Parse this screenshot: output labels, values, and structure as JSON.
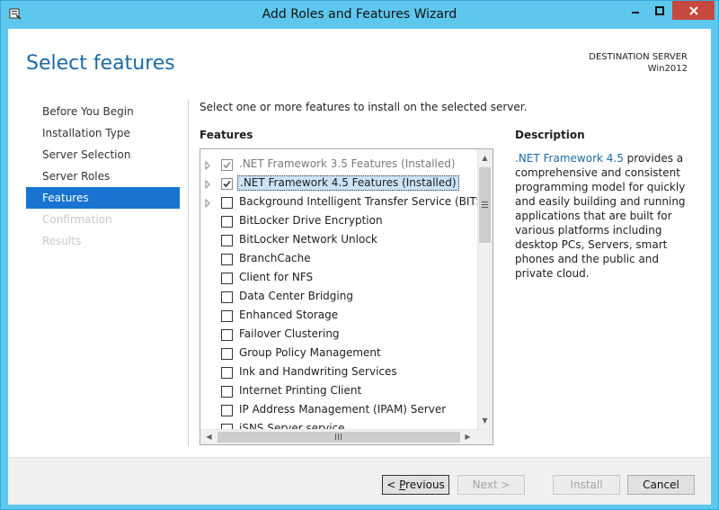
{
  "window": {
    "title": "Add Roles and Features Wizard"
  },
  "page": {
    "title": "Select features"
  },
  "destination": {
    "label": "DESTINATION SERVER",
    "server": "Win2012"
  },
  "nav": {
    "items": [
      {
        "label": "Before You Begin",
        "state": "normal"
      },
      {
        "label": "Installation Type",
        "state": "normal"
      },
      {
        "label": "Server Selection",
        "state": "normal"
      },
      {
        "label": "Server Roles",
        "state": "normal"
      },
      {
        "label": "Features",
        "state": "active"
      },
      {
        "label": "Confirmation",
        "state": "disabled"
      },
      {
        "label": "Results",
        "state": "disabled"
      }
    ]
  },
  "main": {
    "intro": "Select one or more features to install on the selected server.",
    "features_label": "Features",
    "features": [
      {
        "label": ".NET Framework 3.5 Features (Installed)",
        "expandable": true,
        "checked": true,
        "installed": true,
        "selected": false
      },
      {
        "label": ".NET Framework 4.5 Features (Installed)",
        "expandable": true,
        "checked": true,
        "installed": false,
        "selected": true
      },
      {
        "label": "Background Intelligent Transfer Service (BITS)",
        "expandable": true,
        "checked": false,
        "installed": false,
        "selected": false
      },
      {
        "label": "BitLocker Drive Encryption",
        "expandable": false,
        "checked": false,
        "installed": false,
        "selected": false
      },
      {
        "label": "BitLocker Network Unlock",
        "expandable": false,
        "checked": false,
        "installed": false,
        "selected": false
      },
      {
        "label": "BranchCache",
        "expandable": false,
        "checked": false,
        "installed": false,
        "selected": false
      },
      {
        "label": "Client for NFS",
        "expandable": false,
        "checked": false,
        "installed": false,
        "selected": false
      },
      {
        "label": "Data Center Bridging",
        "expandable": false,
        "checked": false,
        "installed": false,
        "selected": false
      },
      {
        "label": "Enhanced Storage",
        "expandable": false,
        "checked": false,
        "installed": false,
        "selected": false
      },
      {
        "label": "Failover Clustering",
        "expandable": false,
        "checked": false,
        "installed": false,
        "selected": false
      },
      {
        "label": "Group Policy Management",
        "expandable": false,
        "checked": false,
        "installed": false,
        "selected": false
      },
      {
        "label": "Ink and Handwriting Services",
        "expandable": false,
        "checked": false,
        "installed": false,
        "selected": false
      },
      {
        "label": "Internet Printing Client",
        "expandable": false,
        "checked": false,
        "installed": false,
        "selected": false
      },
      {
        "label": "IP Address Management (IPAM) Server",
        "expandable": false,
        "checked": false,
        "installed": false,
        "selected": false
      },
      {
        "label": "iSNS Server service",
        "expandable": false,
        "checked": false,
        "installed": false,
        "selected": false
      }
    ]
  },
  "description": {
    "title": "Description",
    "link_text": ".NET Framework 4.5",
    "text": " provides a comprehensive and consistent programming model for quickly and easily building and running applications that are built for various platforms including desktop PCs, Servers, smart phones and the public and private cloud."
  },
  "buttons": {
    "previous_prefix": "< ",
    "previous_key": "P",
    "previous_rest": "revious",
    "next": "Next >",
    "install": "Install",
    "cancel": "Cancel"
  },
  "colors": {
    "accent": "#1874d0",
    "title_bar": "#5ec7ee",
    "close_button": "#c7483e",
    "link": "#1b6aa8"
  }
}
